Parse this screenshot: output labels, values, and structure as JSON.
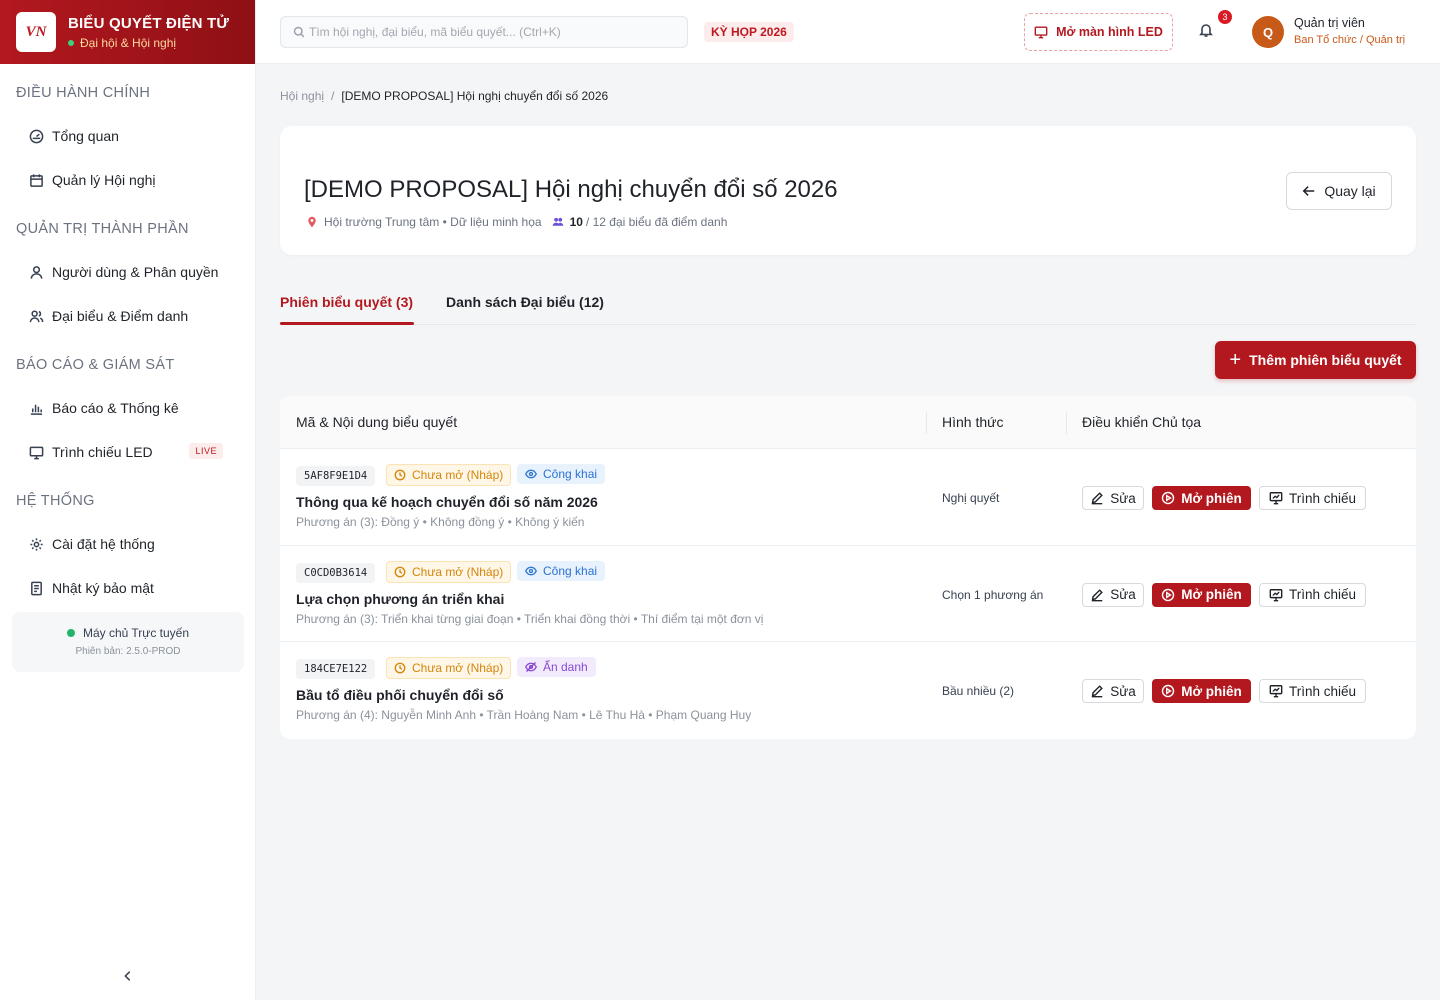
{
  "brand": {
    "logo_text": "VN",
    "title": "BIỂU QUYẾT ĐIỆN TỬ",
    "subtitle": "Đại hội & Hội nghị"
  },
  "sidebar": {
    "sections": [
      {
        "title": "ĐIỀU HÀNH CHÍNH",
        "items": [
          {
            "label": "Tổng quan",
            "icon": "gauge-icon"
          },
          {
            "label": "Quản lý Hội nghị",
            "icon": "calendar-icon"
          }
        ]
      },
      {
        "title": "QUẢN TRỊ THÀNH PHẦN",
        "items": [
          {
            "label": "Người dùng & Phân quyền",
            "icon": "user-icon"
          },
          {
            "label": "Đại biểu & Điểm danh",
            "icon": "users-icon"
          }
        ]
      },
      {
        "title": "BÁO CÁO & GIÁM SÁT",
        "items": [
          {
            "label": "Báo cáo & Thống kê",
            "icon": "bar-chart-icon"
          },
          {
            "label": "Trình chiếu LED",
            "icon": "monitor-icon",
            "badge": "LIVE"
          }
        ]
      },
      {
        "title": "HỆ THỐNG",
        "items": [
          {
            "label": "Cài đặt hệ thống",
            "icon": "gear-icon"
          },
          {
            "label": "Nhật ký bảo mật",
            "icon": "log-icon"
          }
        ]
      }
    ],
    "server": {
      "status": "Máy chủ Trực tuyến",
      "version": "Phiên bản: 2.5.0-PROD"
    }
  },
  "topbar": {
    "search_placeholder": "Tìm hội nghị, đại biểu, mã biểu quyết... (Ctrl+K)",
    "session_tag": "KỲ HỌP 2026",
    "led_button": "Mở màn hình LED",
    "notification_count": "3",
    "avatar_initial": "Q",
    "user_name": "Quản trị viên",
    "user_role": "Ban Tổ chức / Quản trị"
  },
  "breadcrumb": {
    "parent": "Hội nghị",
    "separator": "/",
    "current": "[DEMO PROPOSAL] Hội nghị chuyển đổi số 2026"
  },
  "header": {
    "title": "[DEMO PROPOSAL] Hội nghị chuyển đổi số 2026",
    "location": "Hội trường Trung tâm • Dữ liệu minh họa",
    "attendance_count": "10",
    "attendance_rest": "/ 12 đại biểu đã điểm danh",
    "back_button": "Quay lại"
  },
  "tabs": [
    {
      "label": "Phiên biểu quyết (3)",
      "active": true
    },
    {
      "label": "Danh sách Đại biểu (12)",
      "active": false
    }
  ],
  "add_button": "Thêm phiên biểu quyết",
  "table": {
    "columns": [
      "Mã & Nội dung biểu quyết",
      "Hình thức",
      "Điều khiển Chủ tọa"
    ],
    "actions": {
      "edit": "Sửa",
      "open": "Mở phiên",
      "present": "Trình chiếu"
    },
    "rows": [
      {
        "code": "5AF8F9E1D4",
        "status": "Chưa mở (Nháp)",
        "visibility": "Công khai",
        "visibility_type": "public",
        "title": "Thông qua kế hoạch chuyển đổi số năm 2026",
        "options": "Phương án (3): Đồng ý • Không đồng ý • Không ý kiến",
        "type": "Nghị quyết"
      },
      {
        "code": "C0CD0B3614",
        "status": "Chưa mở (Nháp)",
        "visibility": "Công khai",
        "visibility_type": "public",
        "title": "Lựa chọn phương án triển khai",
        "options": "Phương án (3): Triển khai từng giai đoạn • Triển khai đồng thời • Thí điểm tại một đơn vị",
        "type": "Chọn 1 phương án"
      },
      {
        "code": "184CE7E122",
        "status": "Chưa mở (Nháp)",
        "visibility": "Ẩn danh",
        "visibility_type": "anon",
        "title": "Bầu tổ điều phối chuyển đổi số",
        "options": "Phương án (4): Nguyễn Minh Anh • Trần Hoàng Nam • Lê Thu Hà • Phạm Quang Huy",
        "type": "Bầu nhiều (2)"
      }
    ]
  },
  "colors": {
    "brand": "#b3181f",
    "accent_orange": "#c85a19",
    "status_draft": "#d4860b",
    "public": "#2a72d4",
    "anon": "#8a48d6"
  }
}
